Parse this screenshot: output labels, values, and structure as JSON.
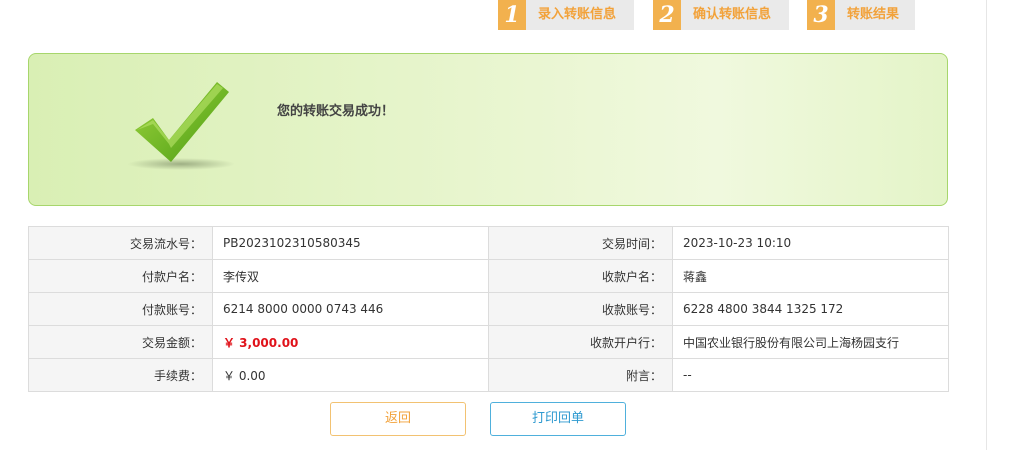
{
  "steps": [
    {
      "num": "1",
      "label": "录入转账信息"
    },
    {
      "num": "2",
      "label": "确认转账信息"
    },
    {
      "num": "3",
      "label": "转账结果"
    }
  ],
  "result": {
    "message": "您的转账交易成功！"
  },
  "details": {
    "serial_label": "交易流水号：",
    "serial_value": "PB2023102310580345",
    "time_label": "交易时间：",
    "time_value": "2023-10-23 10:10",
    "payer_name_label": "付款户名：",
    "payer_name_value": "李传双",
    "payee_name_label": "收款户名：",
    "payee_name_value": "蒋鑫",
    "payer_account_label": "付款账号：",
    "payer_account_value": "6214 8000 0000 0743 446",
    "payee_account_label": "收款账号：",
    "payee_account_value": "6228 4800 3844 1325 172",
    "amount_label": "交易金额：",
    "amount_value": "￥ 3,000.00",
    "payee_bank_label": "收款开户行：",
    "payee_bank_value": "中国农业银行股份有限公司上海杨园支行",
    "fee_label": "手续费：",
    "fee_value": "￥ 0.00",
    "remark_label": "附言：",
    "remark_value": "--"
  },
  "buttons": {
    "back": "返回",
    "print": "打印回单"
  },
  "colors": {
    "step_accent": "#f2b14e",
    "panel_green": "#d9efb4",
    "amount_red": "#e0121a",
    "print_blue": "#2f9ad0"
  }
}
